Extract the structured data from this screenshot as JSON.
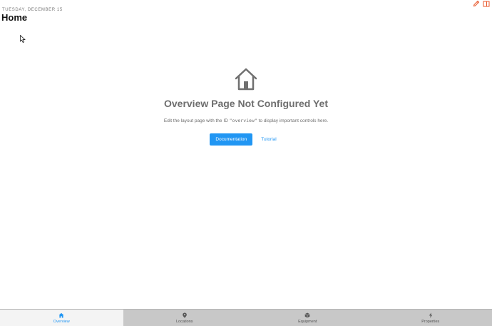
{
  "header": {
    "date": "TUESDAY, DECEMBER 15",
    "title": "Home",
    "icons": [
      "pencil-icon",
      "panel-icon"
    ]
  },
  "empty_state": {
    "icon": "home-icon",
    "title": "Overview Page Not Configured Yet",
    "description_before": "Edit the layout page with the ID ",
    "description_code": "\"overview\"",
    "description_after": " to display important controls here.",
    "primary_button": "Documentation",
    "secondary_button": "Tutorial"
  },
  "tabs": [
    {
      "label": "Overview",
      "icon": "home-icon",
      "active": true
    },
    {
      "label": "Locations",
      "icon": "map-marker-icon",
      "active": false
    },
    {
      "label": "Equipment",
      "icon": "cube-icon",
      "active": false
    },
    {
      "label": "Properties",
      "icon": "bolt-icon",
      "active": false
    }
  ],
  "colors": {
    "accent": "#2196f3",
    "edit_icons": "#e8562a",
    "tabbar_bg": "#c8c8c8",
    "muted_text": "#6e6e6e"
  }
}
